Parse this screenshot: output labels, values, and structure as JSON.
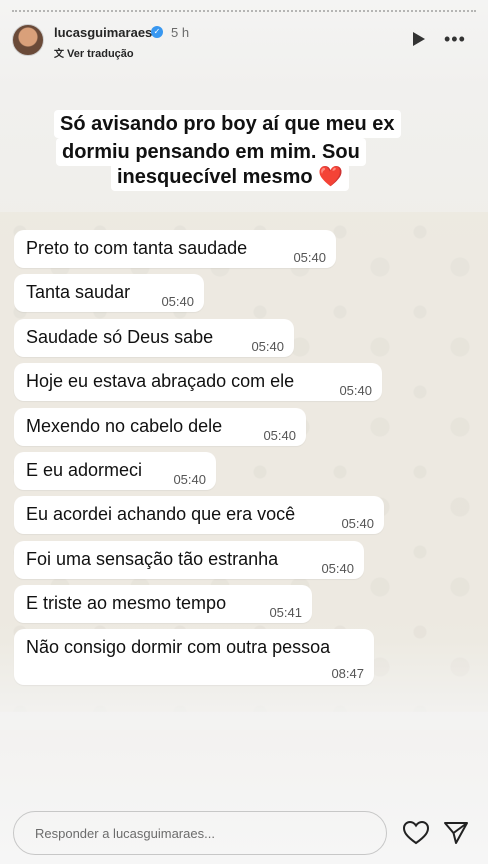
{
  "header": {
    "username": "lucasguimaraes",
    "time": "5 h",
    "translate_label": "Ver tradução"
  },
  "caption": {
    "line1": "Só avisando pro boy aí que meu ex",
    "line2": "dormiu pensando em mim. Sou",
    "line3": "inesquecível mesmo",
    "emoji": "❤️"
  },
  "chat": {
    "messages": [
      {
        "text": "Preto to com tanta saudade",
        "time": "05:40"
      },
      {
        "text": "Tanta saudar",
        "time": "05:40"
      },
      {
        "text": "Saudade só Deus sabe",
        "time": "05:40"
      },
      {
        "text": "Hoje eu estava abraçado com ele",
        "time": "05:40"
      },
      {
        "text": "Mexendo no cabelo dele",
        "time": "05:40"
      },
      {
        "text": "E eu adormeci",
        "time": "05:40"
      },
      {
        "text": "Eu acordei achando que era você",
        "time": "05:40"
      },
      {
        "text": "Foi uma sensação tão estranha",
        "time": "05:40"
      },
      {
        "text": "E triste ao mesmo tempo",
        "time": "05:41"
      },
      {
        "text": "Não consigo dormir com outra pessoa",
        "time": "08:47"
      }
    ]
  },
  "reply": {
    "placeholder": "Responder a lucasguimaraes..."
  },
  "icons": {
    "verified": "verified-badge-icon",
    "play": "play-icon",
    "more": "more-options-icon",
    "like": "heart-icon",
    "send": "send-icon"
  },
  "colors": {
    "verified": "#3897f0",
    "heart": "#e0202a"
  }
}
